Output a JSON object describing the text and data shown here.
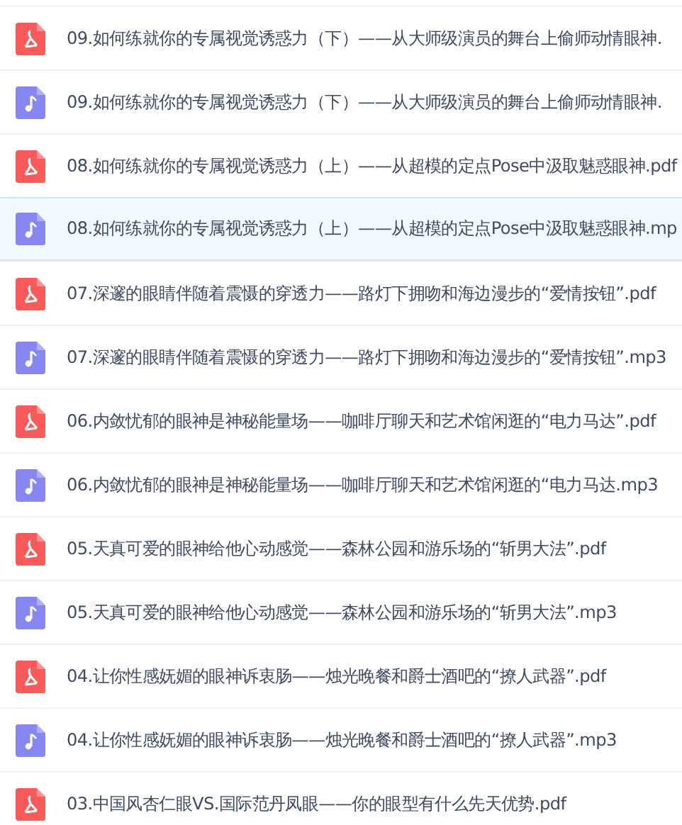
{
  "files": [
    {
      "name": "09.如何练就你的专属视觉诱惑力（下）——从大师级演员的舞台上偷师动情眼神.",
      "kind": "pdf",
      "selected": false
    },
    {
      "name": "09.如何练就你的专属视觉诱惑力（下）——从大师级演员的舞台上偷师动情眼神.",
      "kind": "audio",
      "selected": false
    },
    {
      "name": "08.如何练就你的专属视觉诱惑力（上）——从超模的定点Pose中汲取魅惑眼神.pdf",
      "kind": "pdf",
      "selected": false
    },
    {
      "name": "08.如何练就你的专属视觉诱惑力（上）——从超模的定点Pose中汲取魅惑眼神.mp",
      "kind": "audio",
      "selected": true
    },
    {
      "name": "07.深邃的眼睛伴随着震慑的穿透力——路灯下拥吻和海边漫步的“爱情按钮”.pdf",
      "kind": "pdf",
      "selected": false
    },
    {
      "name": "07.深邃的眼睛伴随着震慑的穿透力——路灯下拥吻和海边漫步的“爱情按钮”.mp3",
      "kind": "audio",
      "selected": false
    },
    {
      "name": "06.内敛忧郁的眼神是神秘能量场——咖啡厅聊天和艺术馆闲逛的“电力马达”.pdf",
      "kind": "pdf",
      "selected": false
    },
    {
      "name": "06.内敛忧郁的眼神是神秘能量场——咖啡厅聊天和艺术馆闲逛的“电力马达.mp3",
      "kind": "audio",
      "selected": false
    },
    {
      "name": "05.天真可爱的眼神给他心动感觉——森林公园和游乐场的“斩男大法”.pdf",
      "kind": "pdf",
      "selected": false
    },
    {
      "name": "05.天真可爱的眼神给他心动感觉——森林公园和游乐场的“斩男大法”.mp3",
      "kind": "audio",
      "selected": false
    },
    {
      "name": "04.让你性感妩媚的眼神诉衷肠——烛光晚餐和爵士酒吧的“撩人武器”.pdf",
      "kind": "pdf",
      "selected": false
    },
    {
      "name": "04.让你性感妩媚的眼神诉衷肠——烛光晚餐和爵士酒吧的“撩人武器”.mp3",
      "kind": "audio",
      "selected": false
    },
    {
      "name": "03.中国风杏仁眼VS.国际范丹凤眼——你的眼型有什么先天优势.pdf",
      "kind": "pdf",
      "selected": false
    }
  ]
}
